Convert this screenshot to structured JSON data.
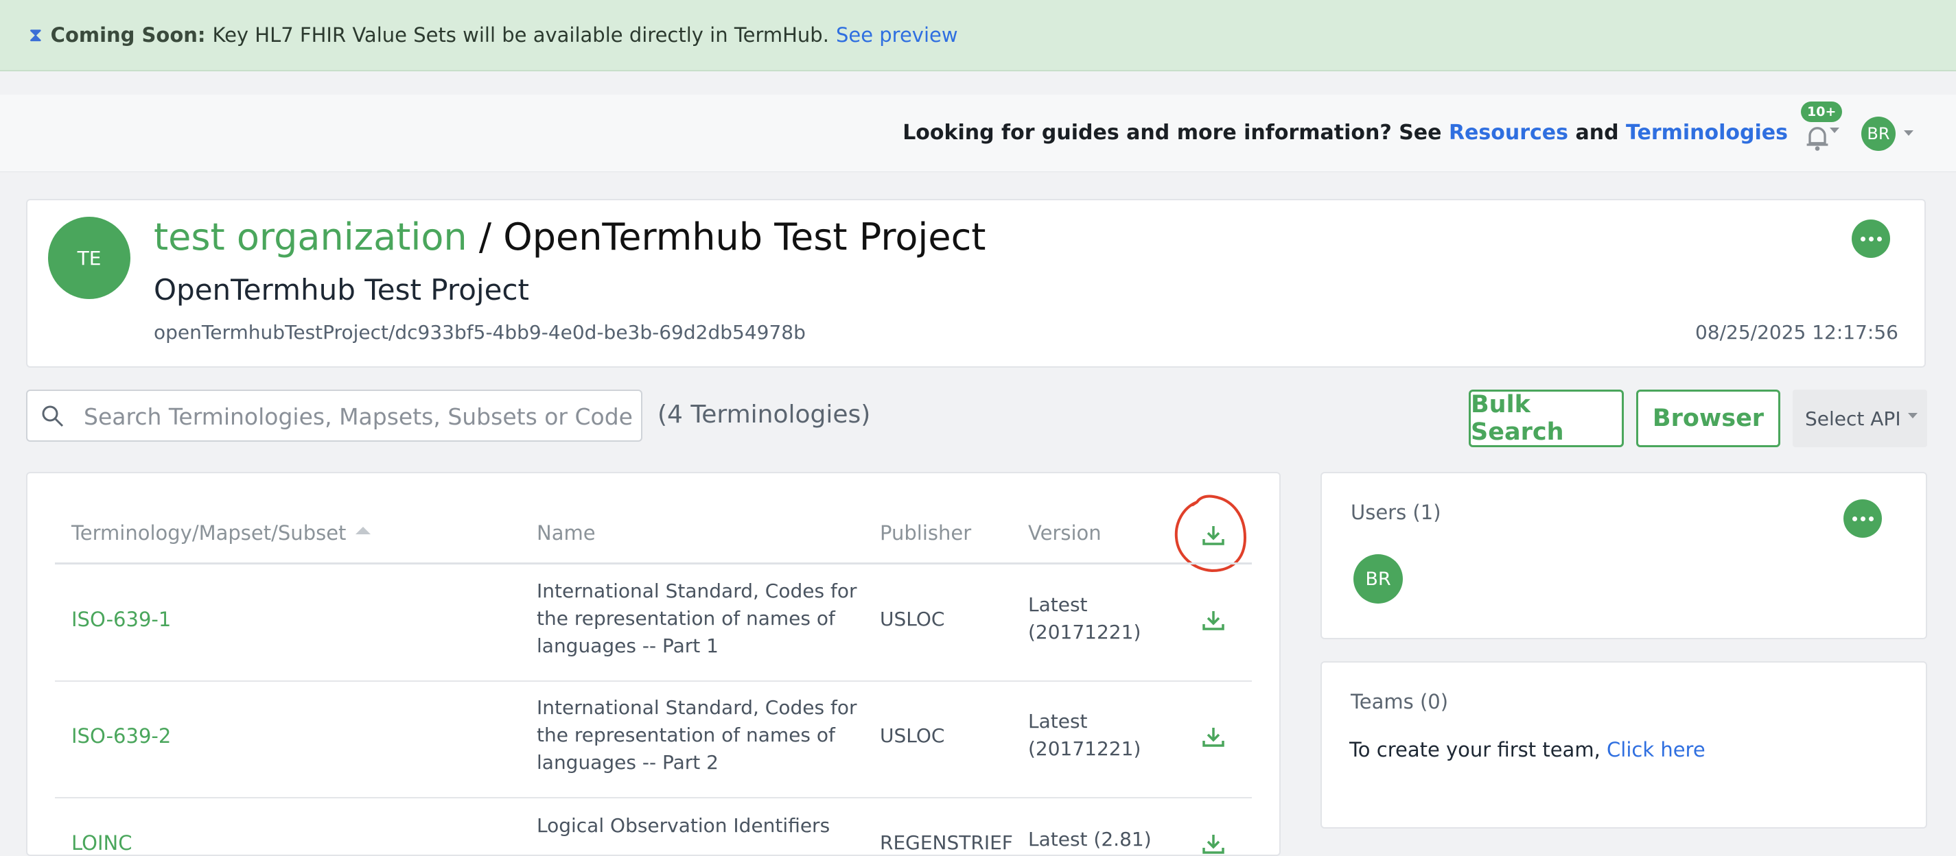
{
  "banner": {
    "icon": "hourglass-icon",
    "bold": "Coming Soon:",
    "text": "Key HL7 FHIR Value Sets will be available directly in TermHub.",
    "link": "See preview"
  },
  "topbar": {
    "message": "Looking for guides and more information? See",
    "resources_link": "Resources",
    "and": "and",
    "terminologies_link": "Terminologies",
    "notification_badge": "10+",
    "user_initials": "BR"
  },
  "project": {
    "avatar_initials": "TE",
    "org_name": "test organization",
    "separator": "/",
    "title": "OpenTermhub Test Project",
    "subtitle": "OpenTermhub Test Project",
    "identifier": "openTermhubTestProject/dc933bf5-4bb9-4e0d-be3b-69d2db54978b",
    "timestamp": "08/25/2025 12:17:56"
  },
  "search": {
    "placeholder": "Search Terminologies, Mapsets, Subsets or Codes",
    "count": "(4 Terminologies)"
  },
  "actions": {
    "bulk_search": "Bulk Search",
    "browser": "Browser",
    "select_api": "Select API"
  },
  "table": {
    "headers": {
      "terminology": "Terminology/Mapset/Subset",
      "name": "Name",
      "publisher": "Publisher",
      "version": "Version"
    },
    "rows": [
      {
        "terminology": "ISO-639-1",
        "name": "International Standard, Codes for the representation of names of languages -- Part 1",
        "publisher": "USLOC",
        "version": "Latest (20171221)"
      },
      {
        "terminology": "ISO-639-2",
        "name": "International Standard, Codes for the representation of names of languages -- Part 2",
        "publisher": "USLOC",
        "version": "Latest (20171221)"
      },
      {
        "terminology": "LOINC",
        "name": "Logical Observation Identifiers",
        "publisher": "REGENSTRIEF",
        "version": "Latest (2.81)"
      }
    ]
  },
  "users": {
    "title": "Users (1)",
    "initials": "BR"
  },
  "teams": {
    "title": "Teams (0)",
    "text": "To create your first team,",
    "link": "Click here"
  },
  "colors": {
    "accent": "#4aa65c",
    "link": "#2f6fe0",
    "banner_bg": "#d9ecdb",
    "annotation": "#e0402a"
  }
}
